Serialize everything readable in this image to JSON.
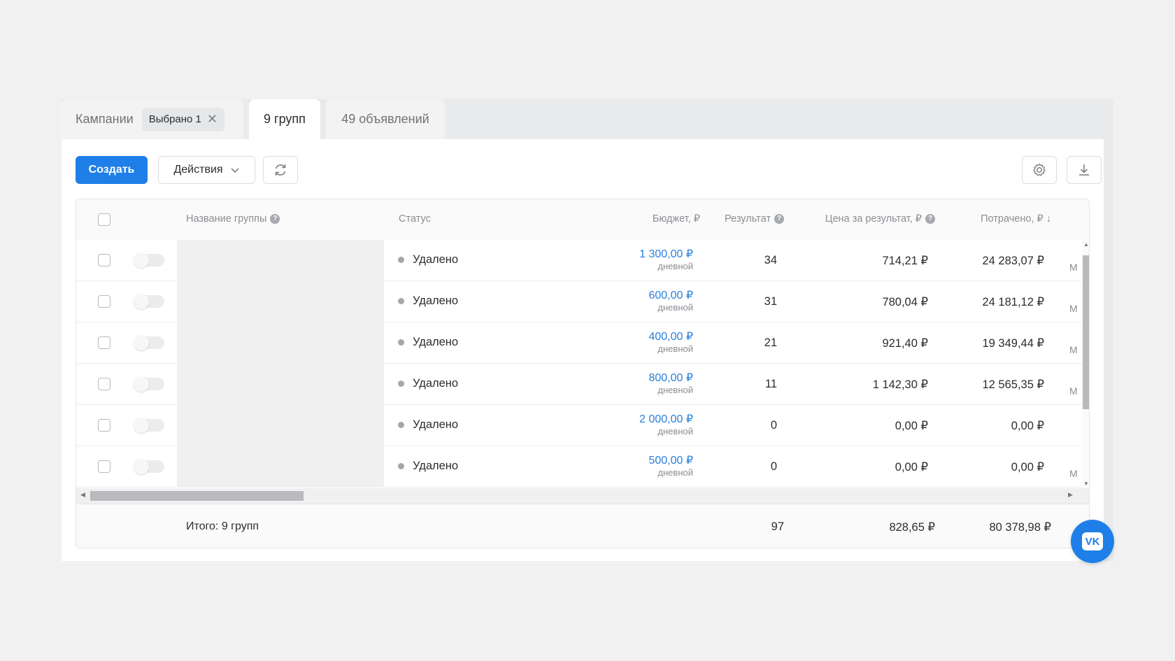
{
  "tabs": {
    "campaigns": {
      "label": "Кампании",
      "chip": "Выбрано 1"
    },
    "groups": {
      "label": "9 групп"
    },
    "ads": {
      "label": "49 объявлений"
    }
  },
  "toolbar": {
    "create_label": "Создать",
    "actions_label": "Действия",
    "icons": [
      "refresh-icon",
      "gear-icon",
      "download-icon"
    ]
  },
  "table": {
    "columns": {
      "name": "Название группы",
      "status": "Статус",
      "budget": "Бюджет, ₽",
      "result": "Результат",
      "cost": "Цена за результат, ₽",
      "spent": "Потрачено, ₽ ↓"
    },
    "rows": [
      {
        "status": "Удалено",
        "budget": "1 300,00 ₽",
        "budget_period": "дневной",
        "result": "34",
        "cost": "714,21 ₽",
        "spent": "24 283,07 ₽",
        "trunc": "М"
      },
      {
        "status": "Удалено",
        "budget": "600,00 ₽",
        "budget_period": "дневной",
        "result": "31",
        "cost": "780,04 ₽",
        "spent": "24 181,12 ₽",
        "trunc": "М"
      },
      {
        "status": "Удалено",
        "budget": "400,00 ₽",
        "budget_period": "дневной",
        "result": "21",
        "cost": "921,40 ₽",
        "spent": "19 349,44 ₽",
        "trunc": "М"
      },
      {
        "status": "Удалено",
        "budget": "800,00 ₽",
        "budget_period": "дневной",
        "result": "11",
        "cost": "1 142,30 ₽",
        "spent": "12 565,35 ₽",
        "trunc": "М"
      },
      {
        "status": "Удалено",
        "budget": "2 000,00 ₽",
        "budget_period": "дневной",
        "result": "0",
        "cost": "0,00 ₽",
        "spent": "0,00 ₽",
        "trunc": ""
      },
      {
        "status": "Удалено",
        "budget": "500,00 ₽",
        "budget_period": "дневной",
        "result": "0",
        "cost": "0,00 ₽",
        "spent": "0,00 ₽",
        "trunc": "М"
      }
    ],
    "footer": {
      "label": "Итого: 9 групп",
      "result": "97",
      "cost": "828,65 ₽",
      "spent": "80 378,98 ₽"
    }
  },
  "colors": {
    "accent": "#1e7fe8",
    "budget_link": "#2a7fd9",
    "status_dot": "#a5a7ab"
  },
  "floating_button": {
    "label": "VK",
    "icon": "vk-logo-icon"
  }
}
